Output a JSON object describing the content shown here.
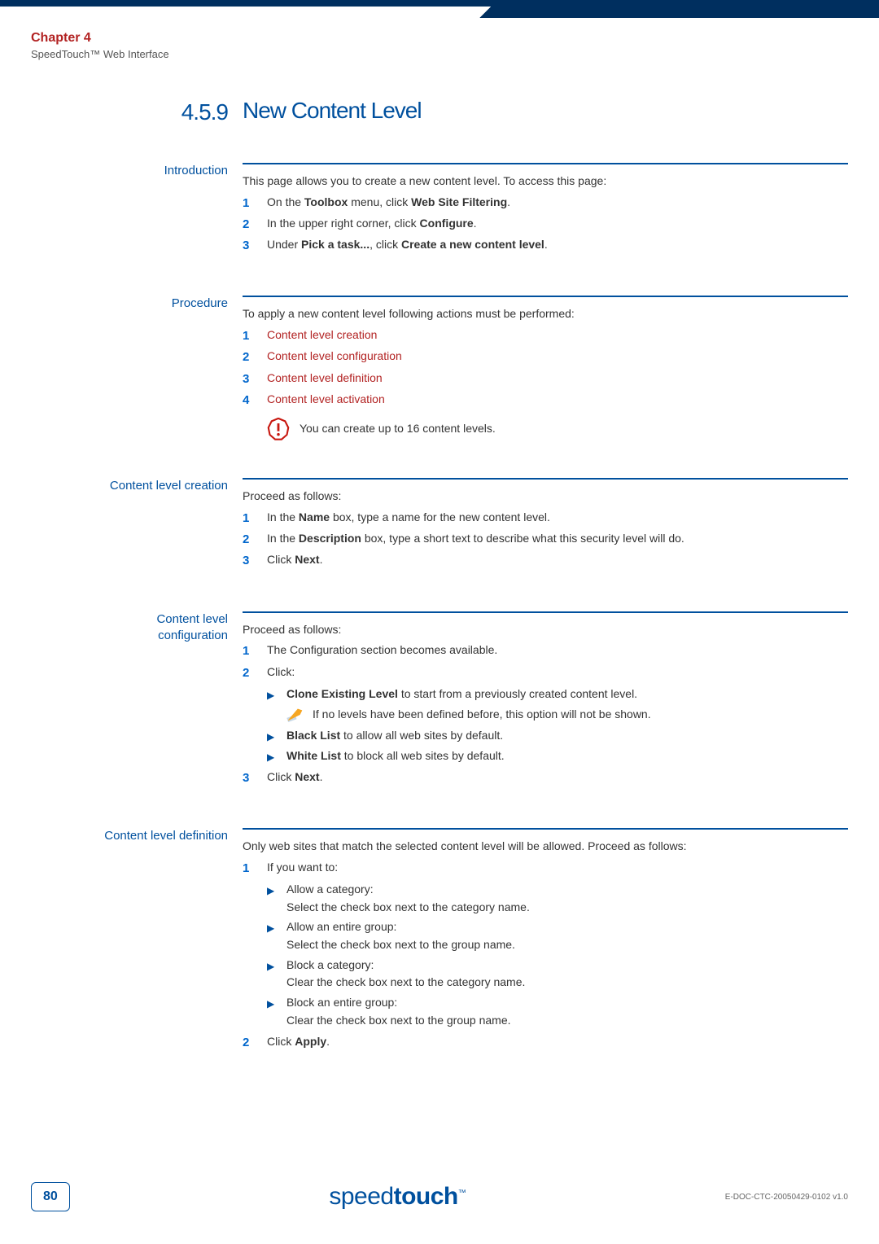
{
  "header": {
    "chapter": "Chapter 4",
    "subtitle": "SpeedTouch™ Web Interface"
  },
  "section": {
    "number": "4.5.9",
    "title": "New Content Level"
  },
  "intro": {
    "label": "Introduction",
    "lead": "This page allows you to create a new content level. To access this page:",
    "steps": [
      {
        "n": "1",
        "pre": "On the ",
        "b1": "Toolbox",
        "mid": " menu, click ",
        "b2": "Web Site Filtering",
        "post": "."
      },
      {
        "n": "2",
        "pre": "In the upper right corner, click ",
        "b1": "Configure",
        "mid": "",
        "b2": "",
        "post": "."
      },
      {
        "n": "3",
        "pre": "Under ",
        "b1": "Pick a task...",
        "mid": ", click ",
        "b2": "Create a new content level",
        "post": "."
      }
    ]
  },
  "proc": {
    "label": "Procedure",
    "lead": "To apply a new content level following actions must be performed:",
    "items": [
      {
        "n": "1",
        "t": "Content level creation"
      },
      {
        "n": "2",
        "t": "Content level configuration"
      },
      {
        "n": "3",
        "t": "Content level definition"
      },
      {
        "n": "4",
        "t": "Content level activation"
      }
    ],
    "warn": "You can create up to 16 content levels."
  },
  "creation": {
    "label": "Content level creation",
    "lead": "Proceed as follows:",
    "steps": [
      {
        "n": "1",
        "pre": "In the ",
        "b": "Name",
        "post": " box, type a name for the new content level."
      },
      {
        "n": "2",
        "pre": "In the ",
        "b": "Description",
        "post": " box, type a short text to describe what this security level will do."
      },
      {
        "n": "3",
        "pre": "Click ",
        "b": "Next",
        "post": "."
      }
    ]
  },
  "config": {
    "label_l1": "Content level",
    "label_l2": "configuration",
    "lead": "Proceed as follows:",
    "s1": {
      "n": "1",
      "t": "The Configuration section becomes available."
    },
    "s2": {
      "n": "2",
      "t": "Click:"
    },
    "b1": {
      "b": "Clone Existing Level",
      "post": " to start from a previously created content level."
    },
    "note": "If no levels have been defined before, this option will not be shown.",
    "b2": {
      "b": "Black List",
      "post": " to allow all web sites by default."
    },
    "b3": {
      "b": "White List",
      "post": " to block all web sites by default."
    },
    "s3": {
      "n": "3",
      "pre": "Click ",
      "b": "Next",
      "post": "."
    }
  },
  "def": {
    "label": "Content level definition",
    "lead": "Only web sites that match the selected content level will be allowed. Proceed as follows:",
    "s1": {
      "n": "1",
      "t": "If you want to:"
    },
    "items": [
      {
        "h": "Allow a category:",
        "d": "Select the check box next to the category name."
      },
      {
        "h": "Allow an entire group:",
        "d": "Select the check box next to the group name."
      },
      {
        "h": "Block a category:",
        "d": "Clear the check box next to the category name."
      },
      {
        "h": "Block an entire group:",
        "d": "Clear the check box next to the group name."
      }
    ],
    "s2": {
      "n": "2",
      "pre": "Click ",
      "b": "Apply",
      "post": "."
    }
  },
  "footer": {
    "page": "80",
    "brand_a": "speed",
    "brand_b": "touch",
    "tm": "™",
    "doc": "E-DOC-CTC-20050429-0102 v1.0"
  }
}
